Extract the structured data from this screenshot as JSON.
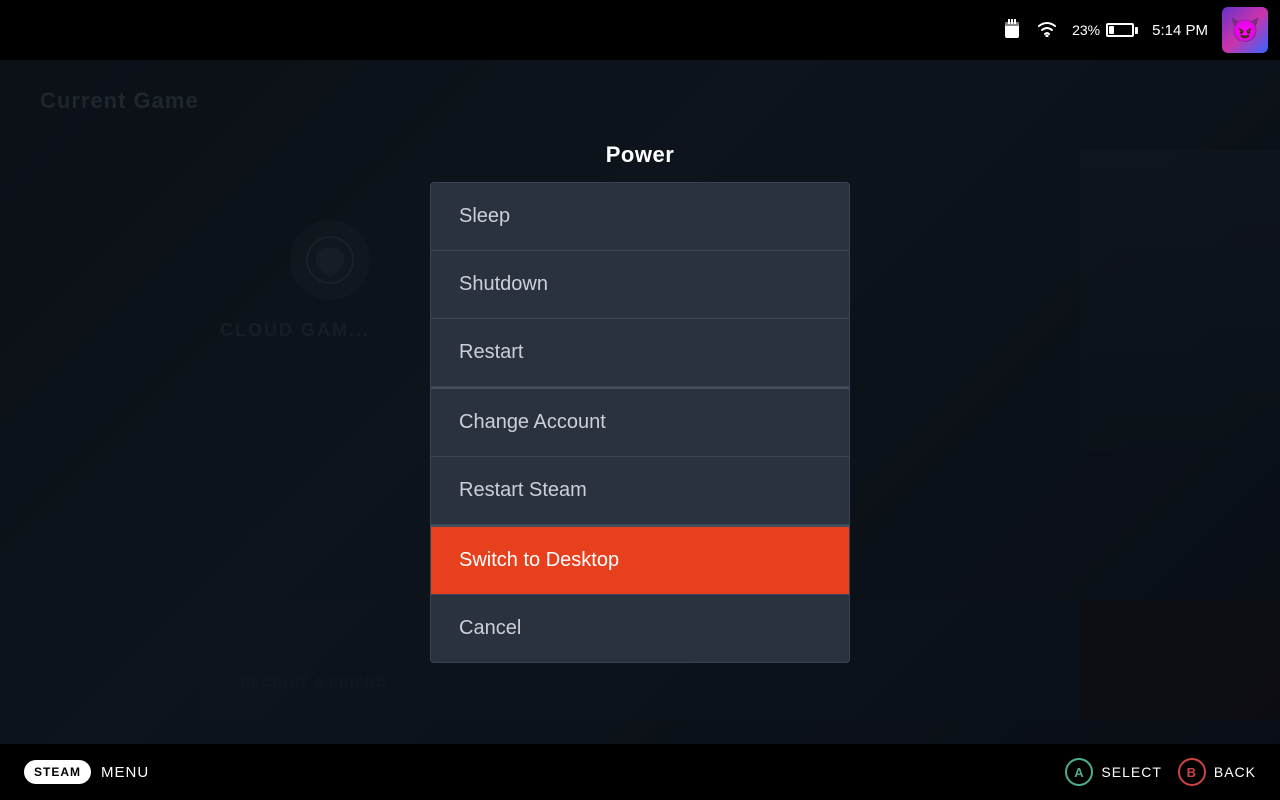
{
  "topbar": {
    "battery_percent": "23%",
    "time": "5:14 PM"
  },
  "background": {
    "section_title": "Current Game"
  },
  "power_modal": {
    "title": "Power",
    "items": [
      {
        "id": "sleep",
        "label": "Sleep",
        "active": false,
        "group": 1
      },
      {
        "id": "shutdown",
        "label": "Shutdown",
        "active": false,
        "group": 1
      },
      {
        "id": "restart",
        "label": "Restart",
        "active": false,
        "group": 1
      },
      {
        "id": "change-account",
        "label": "Change Account",
        "active": false,
        "group": 2
      },
      {
        "id": "restart-steam",
        "label": "Restart Steam",
        "active": false,
        "group": 2
      },
      {
        "id": "switch-desktop",
        "label": "Switch to Desktop",
        "active": true,
        "group": 3
      },
      {
        "id": "cancel",
        "label": "Cancel",
        "active": false,
        "group": 3
      }
    ]
  },
  "bottombar": {
    "steam_label": "STEAM",
    "menu_label": "MENU",
    "select_label": "SELECT",
    "back_label": "BACK",
    "a_button": "A",
    "b_button": "B"
  }
}
